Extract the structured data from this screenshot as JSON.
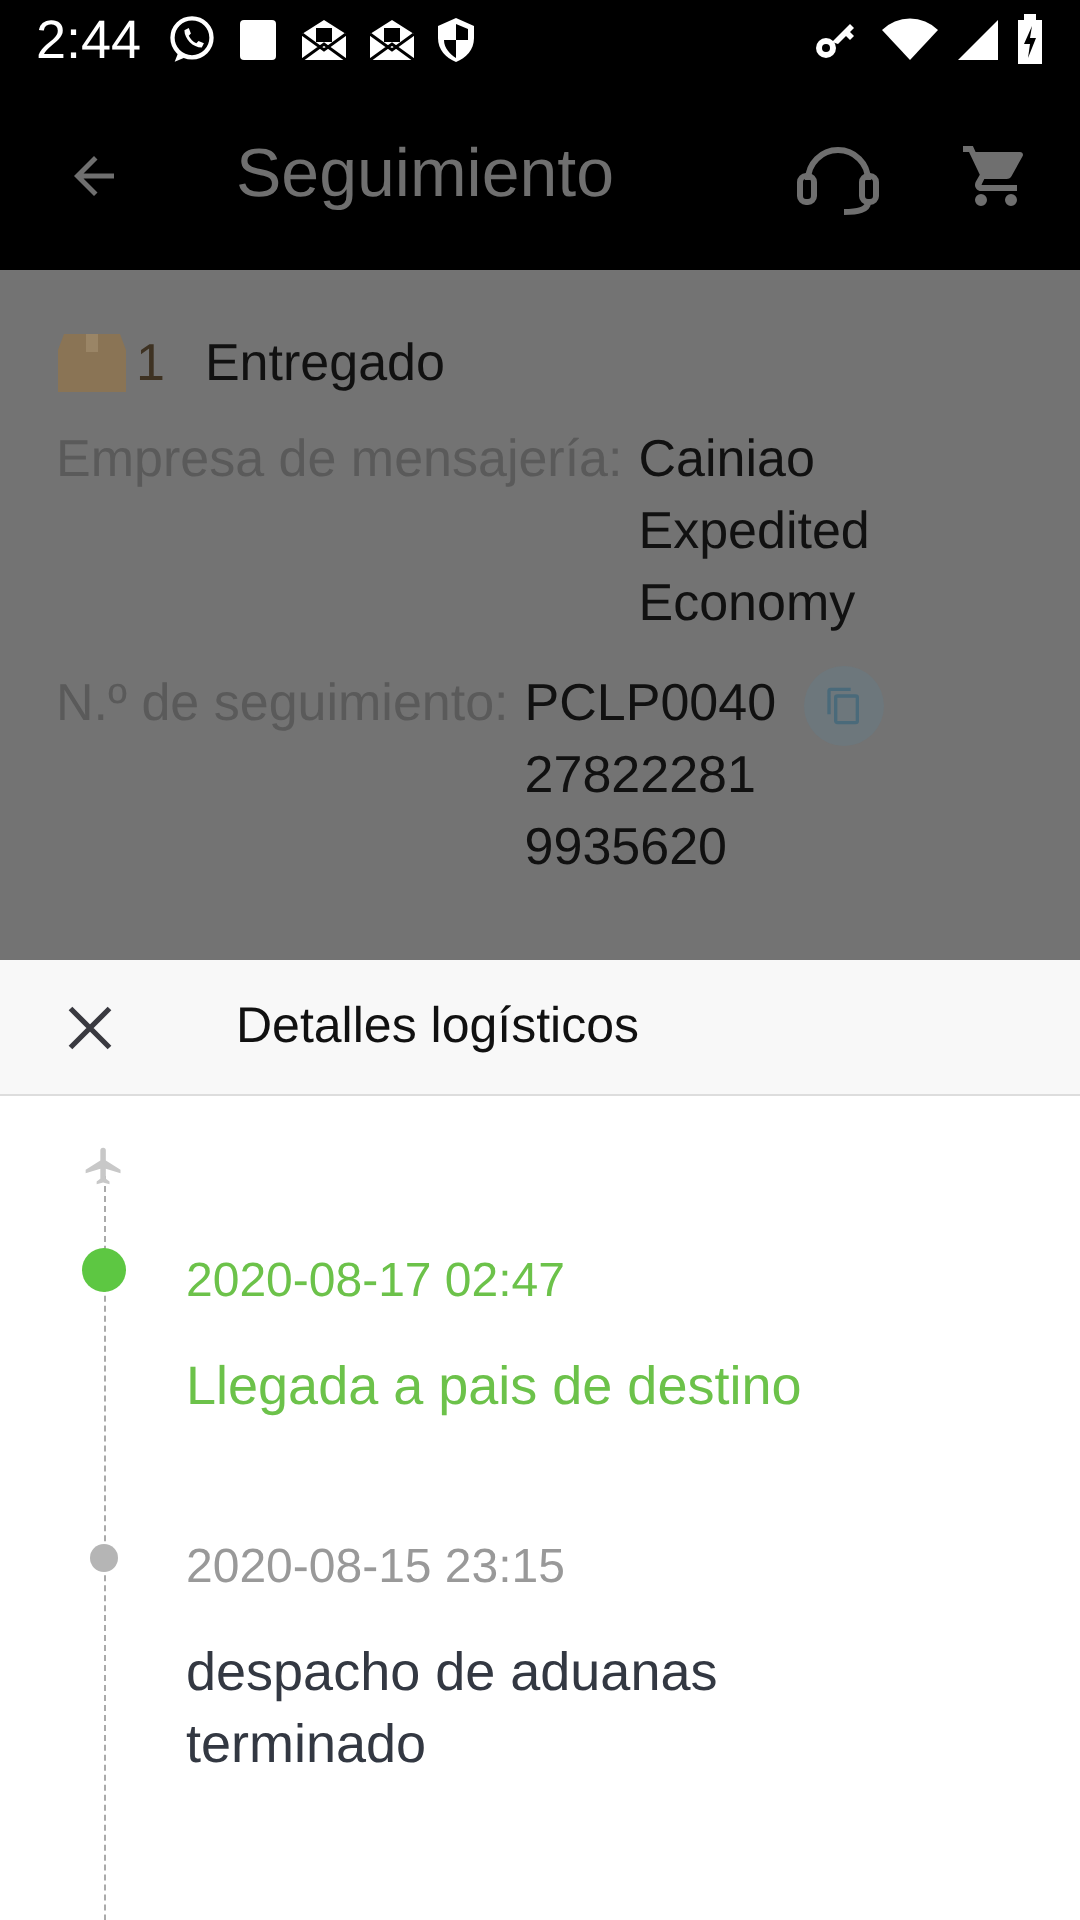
{
  "status_bar": {
    "time": "2:44"
  },
  "app_bar": {
    "title": "Seguimiento"
  },
  "package": {
    "count": "1",
    "status": "Entregado",
    "fields": [
      {
        "label": "Empresa de mensajería:",
        "value": "Cainiao Expedited Economy",
        "kind": "text"
      },
      {
        "label": "N.º de seguimiento:",
        "value": "PCLP0040278222819935620",
        "kind": "copyable"
      }
    ]
  },
  "sheet": {
    "title": "Detalles logísticos",
    "events": [
      {
        "time": "2020-08-17 02:47",
        "description": "Llegada a pais de destino",
        "current": true
      },
      {
        "time": "2020-08-15 23:15",
        "description": "despacho de aduanas terminado",
        "current": false
      }
    ]
  }
}
